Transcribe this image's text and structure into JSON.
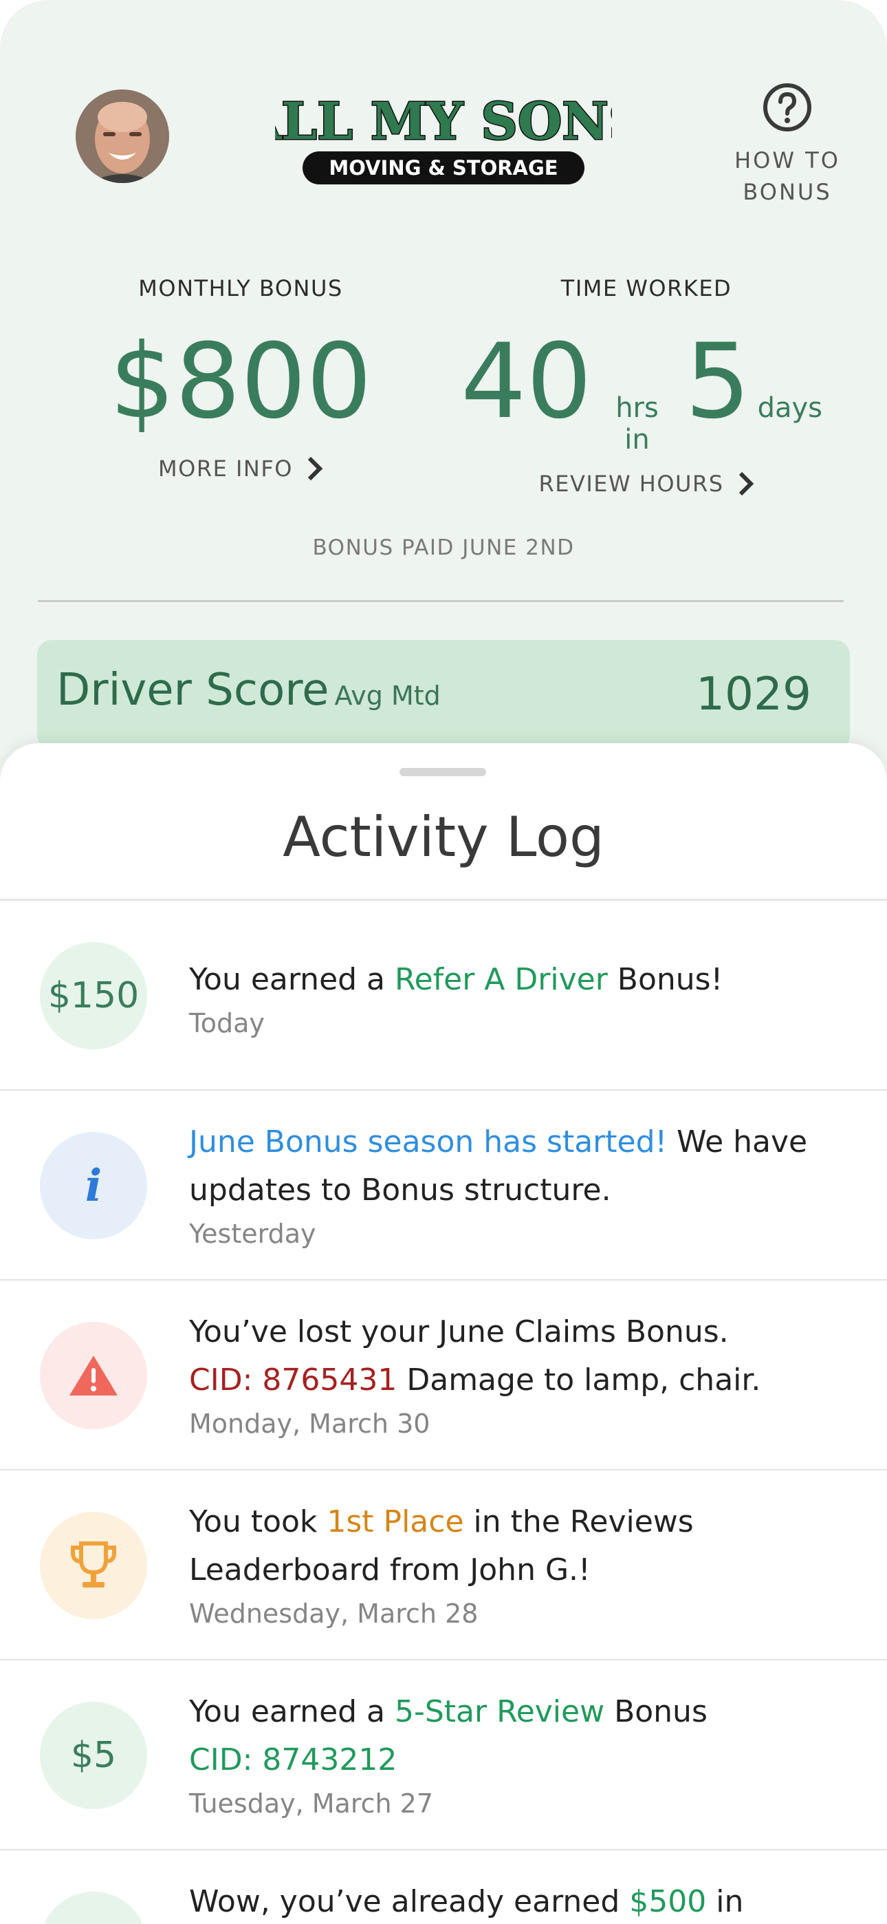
{
  "header": {
    "brand_top": "ALL MY SONS",
    "brand_bottom": "MOVING & STORAGE",
    "help_label": "HOW TO\nBONUS"
  },
  "monthly_bonus": {
    "label": "MONTHLY BONUS",
    "value": "$800",
    "link": "MORE INFO"
  },
  "time_worked": {
    "label": "TIME WORKED",
    "hours": "40",
    "hours_unit": "hrs in",
    "days": "5",
    "days_unit": "days",
    "link": "REVIEW HOURS"
  },
  "bonus_paid": "BONUS PAID JUNE 2ND",
  "driver_score": {
    "title": "Driver Score",
    "subtitle": "Avg Mtd",
    "value": "1029"
  },
  "activity": {
    "title": "Activity Log",
    "items": [
      {
        "badge": "$150",
        "text_pre": "You earned a ",
        "text_hl": "Refer A Driver",
        "text_post": " Bonus!",
        "when": "Today"
      },
      {
        "badge": "i",
        "text_hl": "June Bonus season has started!",
        "text_post": " We have updates to Bonus structure.",
        "when": "Yesterday"
      },
      {
        "text_pre": "You’ve lost your June Claims Bonus.",
        "text_hl": "CID: 8765431",
        "text_post": " Damage to lamp, chair.",
        "when": "Monday, March 30"
      },
      {
        "text_pre": "You took ",
        "text_hl": "1st Place",
        "text_post": " in the Reviews Leaderboard from John G.!",
        "when": "Wednesday, March 28"
      },
      {
        "badge": "$5",
        "text_pre": "You earned a ",
        "text_hl": "5-Star Review",
        "text_post": " Bonus",
        "text_hl2": "CID: 8743212",
        "when": "Tuesday, March 27"
      },
      {
        "text_pre": "Wow, you’ve already earned ",
        "text_hl": "$500",
        "text_post": " in"
      }
    ]
  },
  "colors": {
    "brand_green": "#3a7d5c",
    "highlight_green": "#1f9a5b",
    "highlight_blue": "#2f8ee0",
    "alert_red": "#a62020",
    "trophy_orange": "#d68516",
    "header_bg": "#eef4ef",
    "score_card_bg": "#cfe9d6"
  }
}
